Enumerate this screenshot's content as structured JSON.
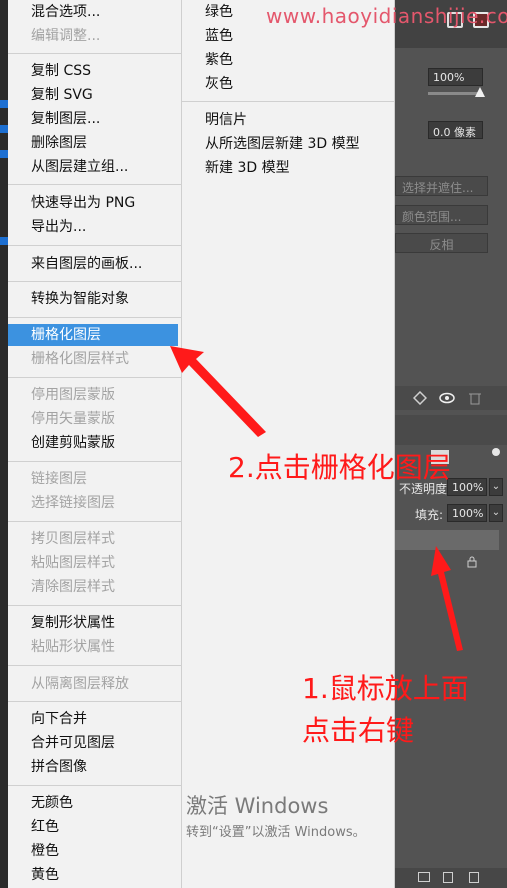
{
  "watermark": "www.haoyidianshijie.com",
  "main_menu": {
    "items": [
      {
        "label": "混合选项...",
        "enabled": true
      },
      {
        "label": "编辑调整...",
        "enabled": false
      },
      {
        "label": "复制 CSS",
        "enabled": true
      },
      {
        "label": "复制 SVG",
        "enabled": true
      },
      {
        "label": "复制图层...",
        "enabled": true
      },
      {
        "label": "删除图层",
        "enabled": true
      },
      {
        "label": "从图层建立组...",
        "enabled": true
      },
      {
        "label": "快速导出为 PNG",
        "enabled": true
      },
      {
        "label": "导出为...",
        "enabled": true
      },
      {
        "label": "来自图层的画板...",
        "enabled": true
      },
      {
        "label": "转换为智能对象",
        "enabled": true
      },
      {
        "label": "栅格化图层",
        "enabled": true,
        "selected": true
      },
      {
        "label": "栅格化图层样式",
        "enabled": false
      },
      {
        "label": "停用图层蒙版",
        "enabled": false
      },
      {
        "label": "停用矢量蒙版",
        "enabled": false
      },
      {
        "label": "创建剪贴蒙版",
        "enabled": true
      },
      {
        "label": "链接图层",
        "enabled": false
      },
      {
        "label": "选择链接图层",
        "enabled": false
      },
      {
        "label": "拷贝图层样式",
        "enabled": false
      },
      {
        "label": "粘贴图层样式",
        "enabled": false
      },
      {
        "label": "清除图层样式",
        "enabled": false
      },
      {
        "label": "复制形状属性",
        "enabled": true
      },
      {
        "label": "粘贴形状属性",
        "enabled": false
      },
      {
        "label": "从隔离图层释放",
        "enabled": false
      },
      {
        "label": "向下合并",
        "enabled": true
      },
      {
        "label": "合并可见图层",
        "enabled": true
      },
      {
        "label": "拼合图像",
        "enabled": true
      },
      {
        "label": "无颜色",
        "enabled": true
      },
      {
        "label": "红色",
        "enabled": true
      },
      {
        "label": "橙色",
        "enabled": true
      },
      {
        "label": "黄色",
        "enabled": true
      }
    ]
  },
  "submenu": {
    "items": [
      {
        "label": "绿色"
      },
      {
        "label": "蓝色"
      },
      {
        "label": "紫色"
      },
      {
        "label": "灰色"
      },
      {
        "label": "明信片"
      },
      {
        "label": "从所选图层新建 3D 模型"
      },
      {
        "label": "新建 3D 模型"
      }
    ]
  },
  "ps_panel": {
    "opacity_top": "100%",
    "feather": "0.0 像素",
    "select_and_mask": "选择并遮住...",
    "color_range": "颜色范围...",
    "invert": "反相",
    "opacity_label": "不透明度:",
    "opacity_value": "100%",
    "fill_label": "填充:",
    "fill_value": "100%"
  },
  "annotations": {
    "step2": "2.点击栅格化图层",
    "step1_line1": "1.鼠标放上面",
    "step1_line2": "点击右键"
  },
  "activation": {
    "title": "激活 Windows",
    "subtitle": "转到“设置”以激活 Windows。"
  },
  "colors": {
    "highlight": "#3c92e0",
    "annotation": "#ff1a1a",
    "watermark": "#e4576c"
  }
}
